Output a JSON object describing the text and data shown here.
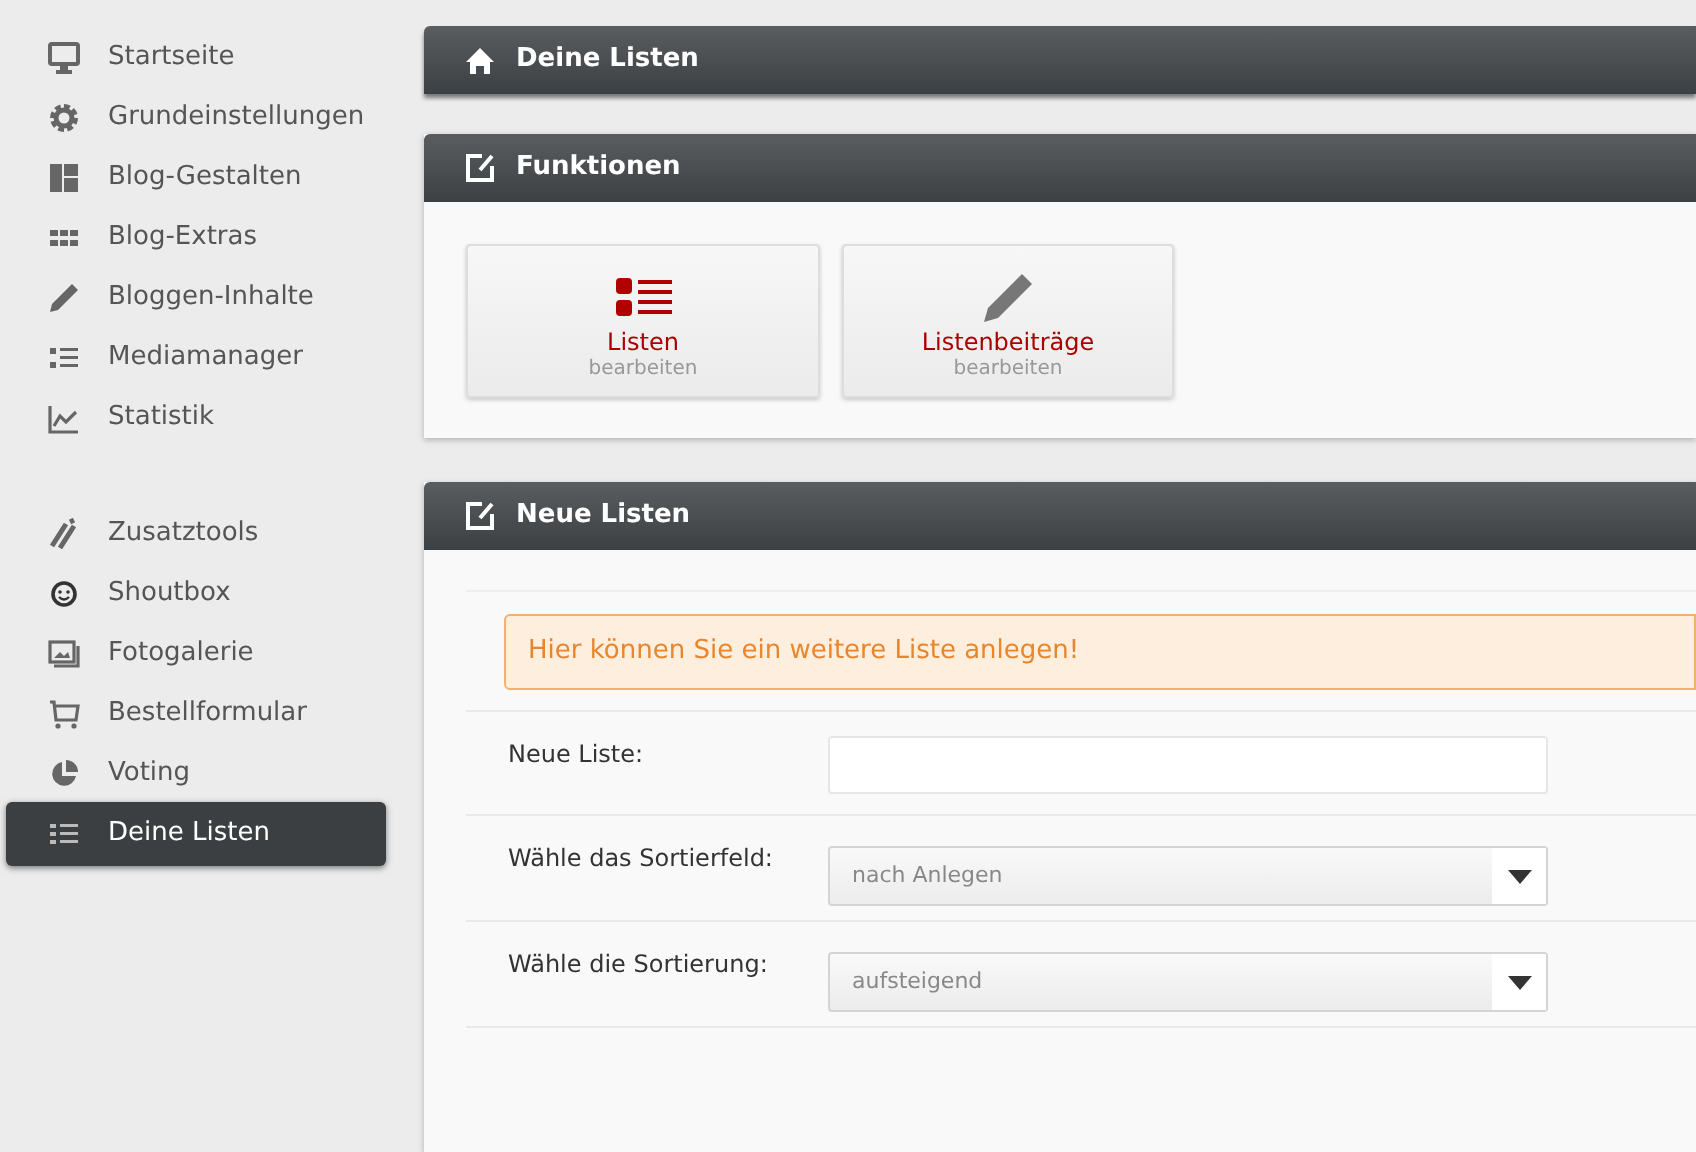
{
  "sidebar": {
    "groups": [
      {
        "items": [
          {
            "label": "Startseite",
            "selected": false
          },
          {
            "label": "Grundeinstellungen",
            "selected": false
          },
          {
            "label": "Blog-Gestalten",
            "selected": false
          },
          {
            "label": "Blog-Extras",
            "selected": false
          },
          {
            "label": "Bloggen-Inhalte",
            "selected": false
          },
          {
            "label": "Mediamanager",
            "selected": false
          },
          {
            "label": "Statistik",
            "selected": false
          }
        ]
      },
      {
        "items": [
          {
            "label": "Zusatztools",
            "selected": false
          },
          {
            "label": "Shoutbox",
            "selected": false
          },
          {
            "label": "Fotogalerie",
            "selected": false
          },
          {
            "label": "Bestellformular",
            "selected": false
          },
          {
            "label": "Voting",
            "selected": false
          },
          {
            "label": "Deine Listen",
            "selected": true
          }
        ]
      }
    ]
  },
  "breadcrumb": {
    "title": "Deine Listen"
  },
  "functions_panel": {
    "title": "Funktionen",
    "tiles": [
      {
        "title": "Listen",
        "subtitle": "bearbeiten"
      },
      {
        "title": "Listenbeiträge",
        "subtitle": "bearbeiten"
      }
    ]
  },
  "new_list_panel": {
    "title": "Neue Listen",
    "notice": "Hier können Sie ein weitere Liste anlegen!",
    "fields": [
      {
        "kind": "text",
        "label": "Neue Liste:"
      },
      {
        "kind": "select",
        "label": "Wähle das Sortierfeld:",
        "value": "nach Anlegen"
      },
      {
        "kind": "select",
        "label": "Wähle die Sortierung:",
        "value": "aufsteigend"
      }
    ]
  }
}
